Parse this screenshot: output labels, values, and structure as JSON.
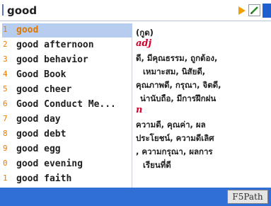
{
  "search": {
    "value": "good"
  },
  "toolbar": {
    "play_icon": "play-icon",
    "edit_icon": "edit-icon"
  },
  "word_list": {
    "items": [
      {
        "num": "1",
        "word": "good",
        "selected": true
      },
      {
        "num": "2",
        "word": "good afternoon"
      },
      {
        "num": "3",
        "word": "good behavior"
      },
      {
        "num": "4",
        "word": "Good Book"
      },
      {
        "num": "5",
        "word": "good cheer"
      },
      {
        "num": "6",
        "word": "Good Conduct Me..."
      },
      {
        "num": "7",
        "word": "good day"
      },
      {
        "num": "8",
        "word": "good debt"
      },
      {
        "num": "9",
        "word": "good egg"
      },
      {
        "num": "0",
        "word": "good evening"
      },
      {
        "num": "1",
        "word": "good faith"
      }
    ]
  },
  "definition": {
    "pronunciation": "(กูด)",
    "pos_adj": "adj",
    "lines_adj": [
      "ดี, มีคุณธรรม, ถูกต้อง,",
      "เหมาะสม, นิสัยดี,",
      "คุณภาพดี, กรุณา, จิตดี,",
      "น่านับถือ, มีการฝึกฝน"
    ],
    "pos_n": "n",
    "lines_n": [
      "ความดี, คุณค่า, ผล",
      "ประโยชน์, ความดีเลิศ",
      ", ความกรุณา, ผลการ",
      "เรียนที่ดี"
    ]
  },
  "status": {
    "button_label": "F5Path"
  },
  "colors": {
    "accent": "#2f6fd6",
    "selection": "#b6cdef",
    "number": "#f07a00",
    "pos": "#d8002a"
  }
}
